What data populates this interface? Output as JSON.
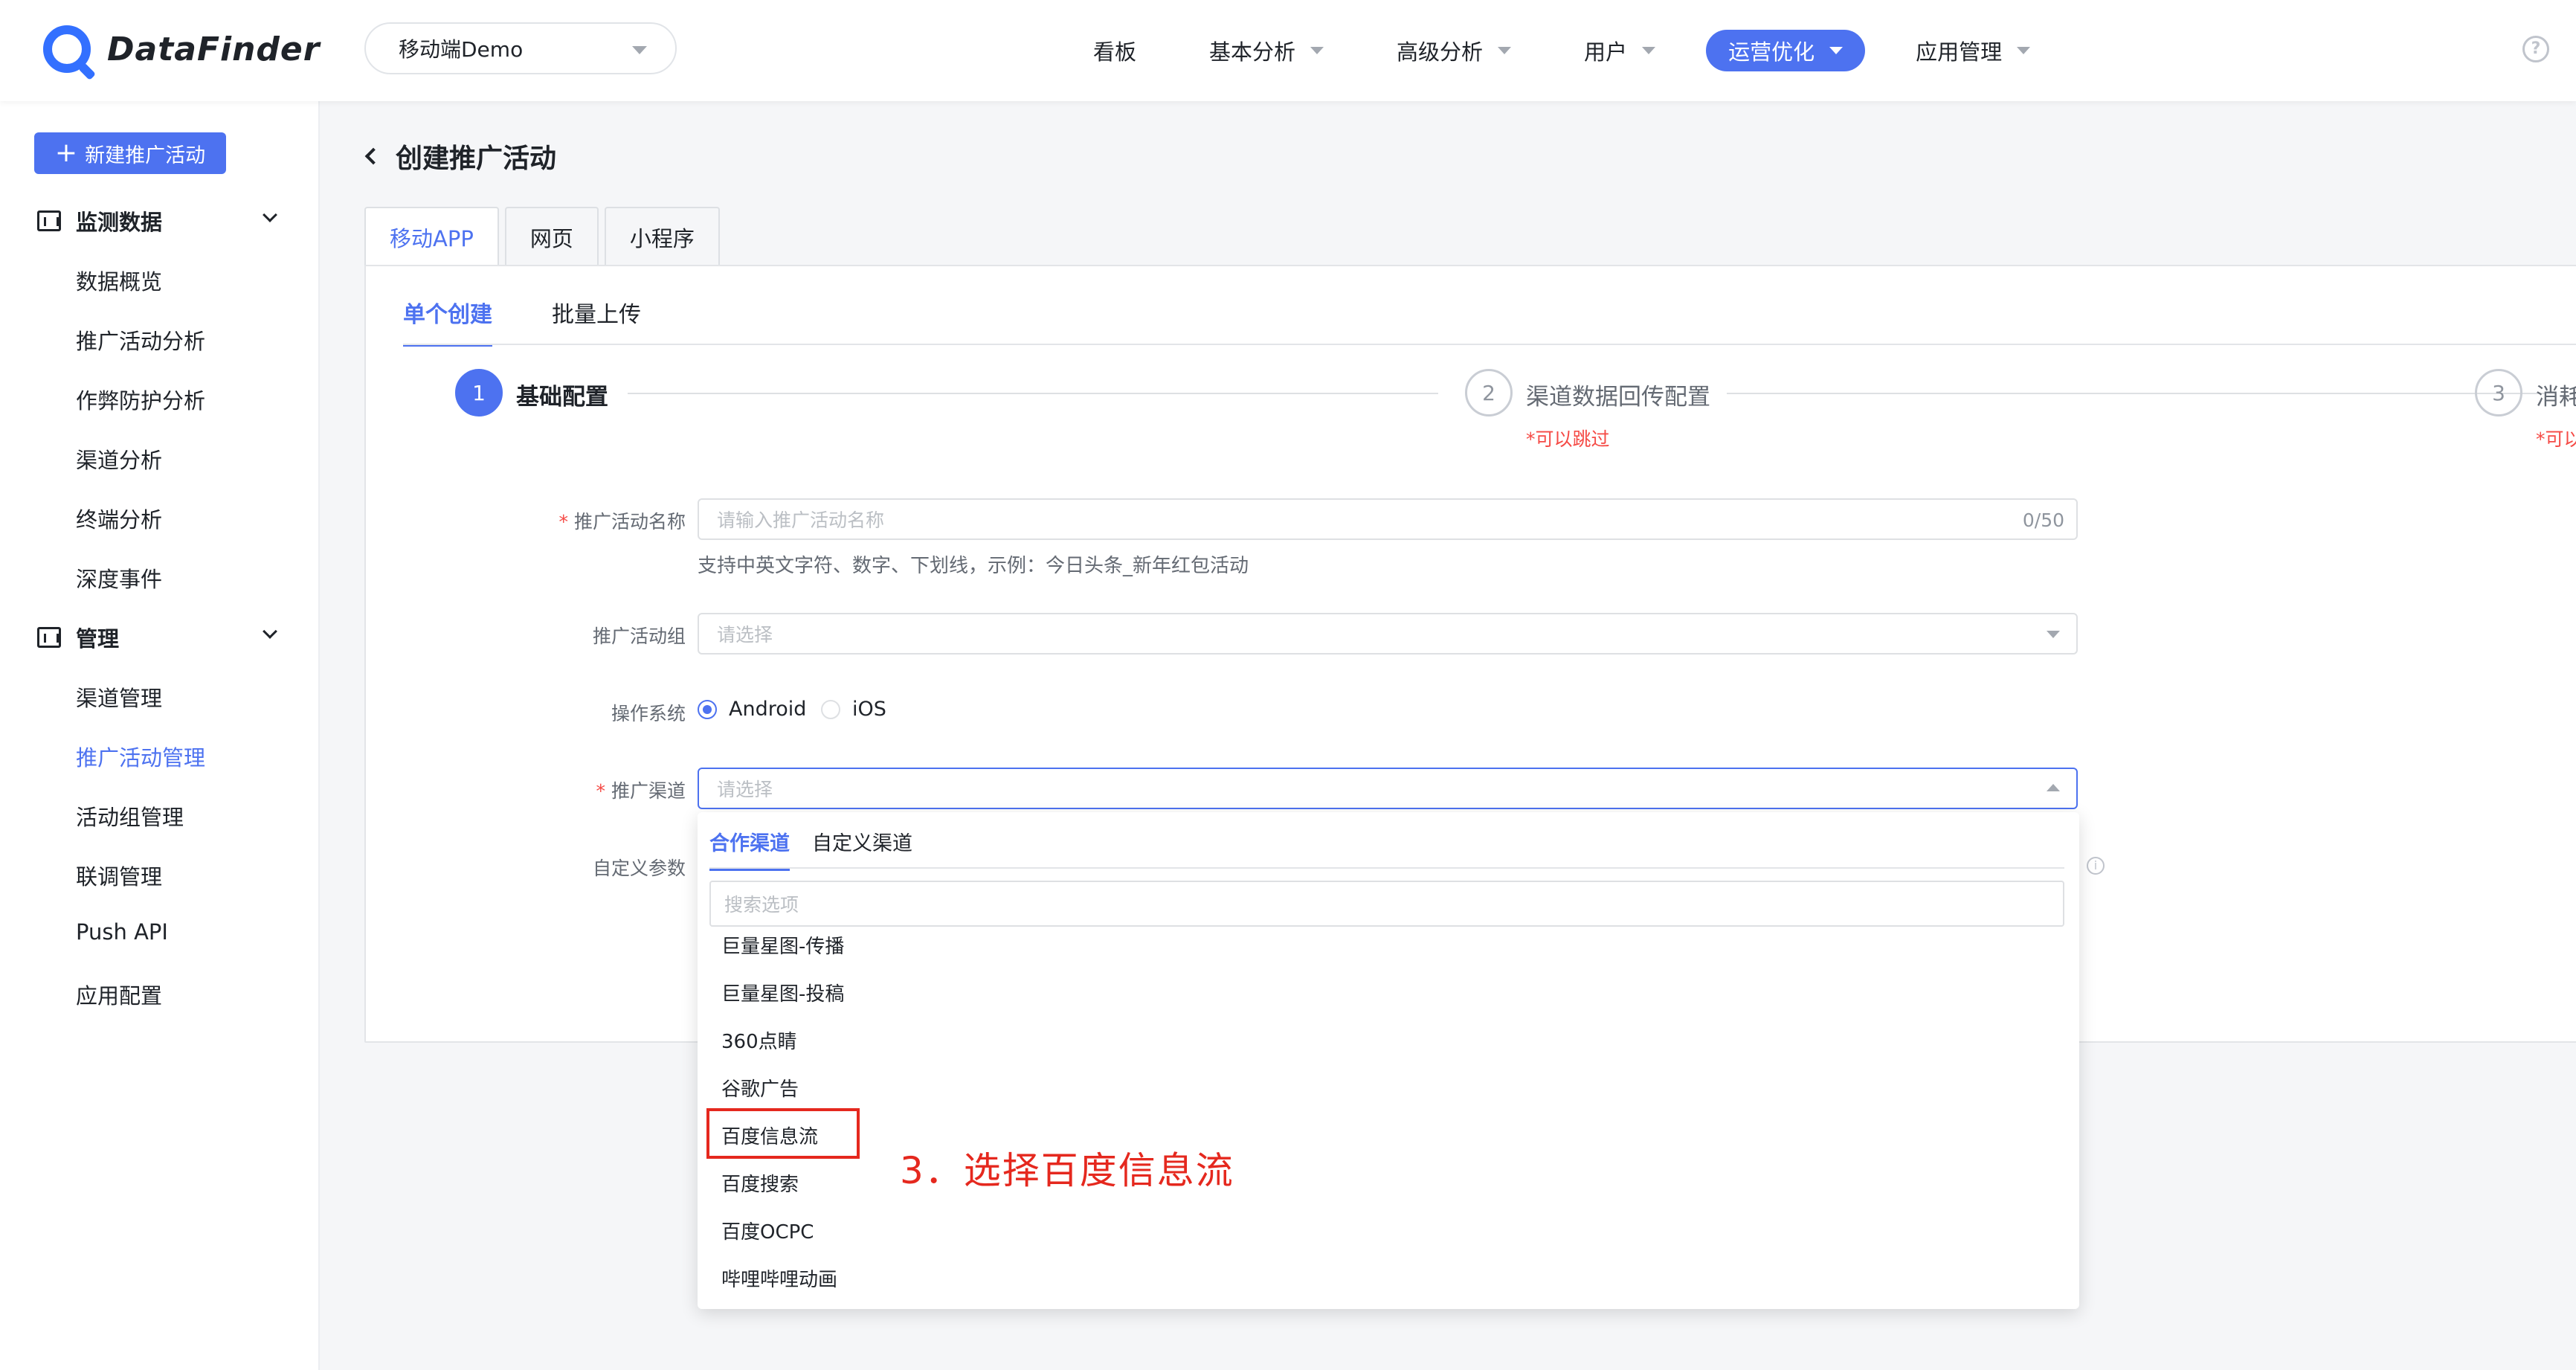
{
  "header": {
    "logo_text": "DataFinder",
    "app_select": "移动端Demo",
    "nav": [
      {
        "label": "看板",
        "has_caret": false,
        "active": false
      },
      {
        "label": "基本分析",
        "has_caret": true,
        "active": false
      },
      {
        "label": "高级分析",
        "has_caret": true,
        "active": false
      },
      {
        "label": "用户",
        "has_caret": true,
        "active": false
      },
      {
        "label": "运营优化",
        "has_caret": true,
        "active": true
      },
      {
        "label": "应用管理",
        "has_caret": true,
        "active": false
      }
    ],
    "help": "?"
  },
  "sidebar": {
    "new_button": "新建推广活动",
    "groups": [
      {
        "label": "监测数据",
        "icon": "chart-box-icon"
      },
      {
        "label": "管理",
        "icon": "monitor-icon"
      }
    ],
    "items": [
      "数据概览",
      "推广活动分析",
      "作弊防护分析",
      "渠道分析",
      "终端分析",
      "深度事件",
      "渠道管理",
      "推广活动管理",
      "活动组管理",
      "联调管理",
      "Push API",
      "应用配置"
    ],
    "active_item": "推广活动管理"
  },
  "main": {
    "title": "创建推广活动",
    "top_tabs": [
      "移动APP",
      "网页",
      "小程序"
    ],
    "sub_tabs": [
      "单个创建",
      "批量上传"
    ],
    "steps": [
      {
        "num": "1",
        "label": "基础配置",
        "skip": ""
      },
      {
        "num": "2",
        "label": "渠道数据回传配置",
        "skip": "*可以跳过"
      },
      {
        "num": "3",
        "label": "消耗",
        "skip": "*可以"
      }
    ],
    "form": {
      "name_label": "推广活动名称",
      "name_placeholder": "请输入推广活动名称",
      "name_count": "0/50",
      "name_hint": "支持中英文字符、数字、下划线，示例：今日头条_新年红包活动",
      "group_label": "推广活动组",
      "group_placeholder": "请选择",
      "os_label": "操作系统",
      "os_options": [
        "Android",
        "iOS"
      ],
      "channel_label": "推广渠道",
      "channel_placeholder": "请选择",
      "custom_label": "自定义参数"
    },
    "dropdown": {
      "tabs": [
        "合作渠道",
        "自定义渠道"
      ],
      "search_placeholder": "搜索选项",
      "items": [
        "巨量星图-传播",
        "巨量星图-投稿",
        "360点睛",
        "谷歌广告",
        "百度信息流",
        "百度搜索",
        "百度OCPC",
        "哔哩哔哩动画"
      ]
    }
  },
  "annotation": "3．选择百度信息流",
  "colors": {
    "accent": "#4d72f0",
    "required": "#f54a45",
    "annotation": "#e5281e"
  }
}
